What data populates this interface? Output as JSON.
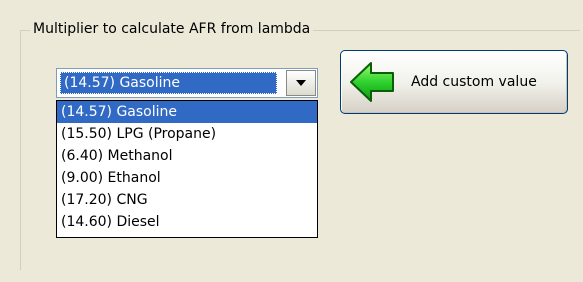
{
  "groupbox": {
    "title": "Multiplier to calculate AFR from lambda"
  },
  "combo": {
    "selected_value": "(14.57) Gasoline",
    "dropdown_icon": "chevron-down-icon"
  },
  "dropdown": {
    "items": [
      "(14.57) Gasoline",
      "(15.50) LPG (Propane)",
      "(6.40) Methanol",
      "(9.00) Ethanol",
      "(17.20) CNG",
      "(14.60) Diesel"
    ],
    "selected_index": 0
  },
  "add_button": {
    "label": "Add custom value",
    "icon": "green-arrow-left-icon"
  },
  "colors": {
    "selection": "#316ac5",
    "window_bg": "#ece9d8",
    "arrow_green": "#2fd12f"
  }
}
